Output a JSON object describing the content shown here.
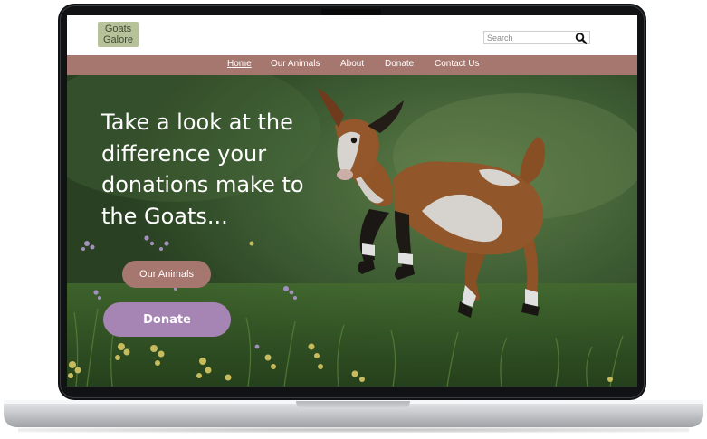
{
  "logo": {
    "line1": "Goats",
    "line2": "Galore"
  },
  "search": {
    "placeholder": "Search",
    "icon": "search-icon"
  },
  "nav": {
    "items": [
      {
        "label": "Home",
        "active": true
      },
      {
        "label": "Our Animals",
        "active": false
      },
      {
        "label": "About",
        "active": false
      },
      {
        "label": "Donate",
        "active": false
      },
      {
        "label": "Contact Us",
        "active": false
      }
    ]
  },
  "hero": {
    "heading": "Take a look at the difference your donations make to the Goats...",
    "image": "leaping-goat-in-meadow"
  },
  "buttons": {
    "our_animals": "Our Animals",
    "donate": "Donate"
  },
  "colors": {
    "nav_bg": "#a6776f",
    "animals_button": "#a6776f",
    "donate_button": "#a685b5",
    "logo_bg": "#b7c29a"
  }
}
